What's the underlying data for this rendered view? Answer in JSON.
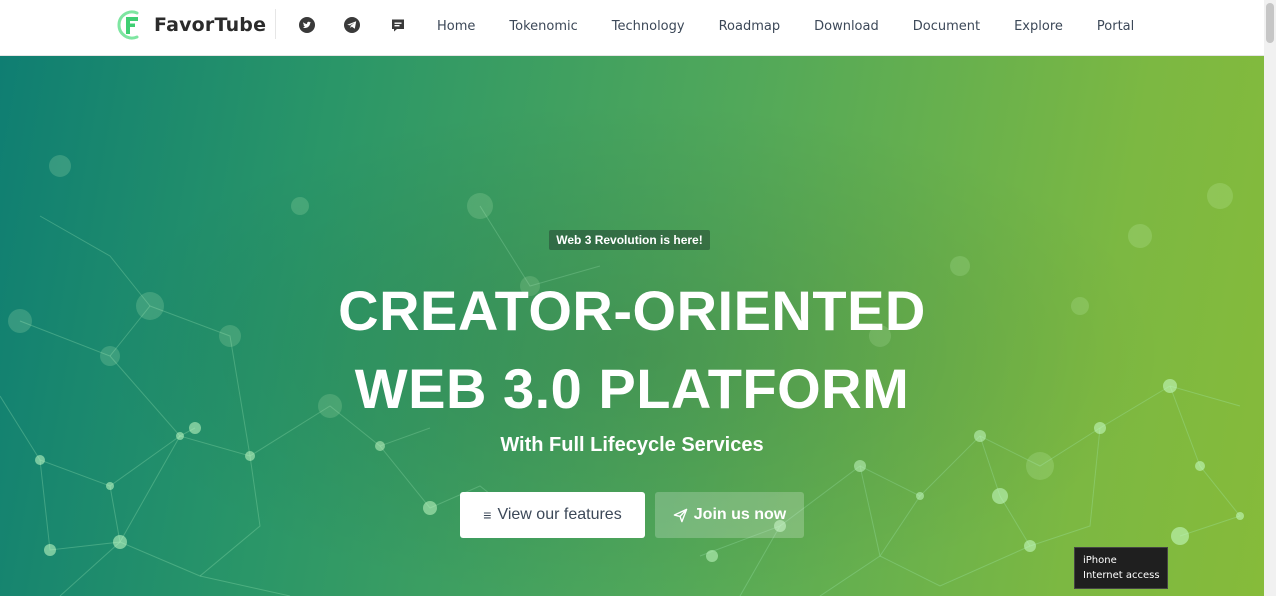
{
  "brand": {
    "name": "FavorTube"
  },
  "social": [
    {
      "icon": "twitter-icon"
    },
    {
      "icon": "telegram-icon"
    },
    {
      "icon": "discord-icon"
    }
  ],
  "nav": [
    "Home",
    "Tokenomic",
    "Technology",
    "Roadmap",
    "Download",
    "Document",
    "Explore",
    "Portal"
  ],
  "hero": {
    "badge": "Web 3 Revolution is here!",
    "title_line1": "CREATOR-ORIENTED",
    "title_line2": "WEB 3.0 PLATFORM",
    "subtitle": "With Full Lifecycle Services",
    "features_button": "View our features",
    "join_button": "Join us now"
  },
  "tooltip": {
    "line1": "iPhone",
    "line2": "Internet access"
  },
  "colors": {
    "brand_green": "#4cd27a",
    "hero_start": "#0f7e72",
    "hero_end": "#86bb3a"
  }
}
